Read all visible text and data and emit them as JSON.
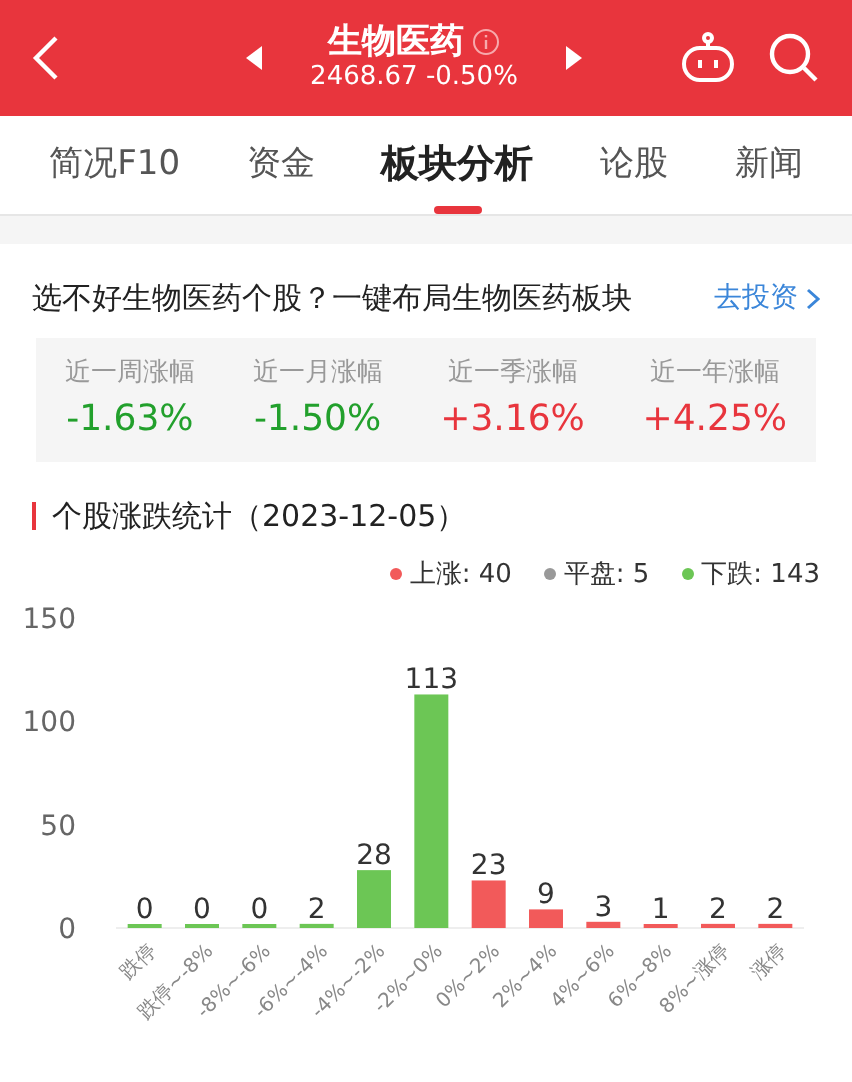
{
  "header": {
    "title": "生物医药",
    "subtitle": "2468.67 -0.50%"
  },
  "tabs": [
    {
      "label": "简况F10",
      "selected": false
    },
    {
      "label": "资金",
      "selected": false
    },
    {
      "label": "板块分析",
      "selected": true
    },
    {
      "label": "论股",
      "selected": false
    },
    {
      "label": "新闻",
      "selected": false
    }
  ],
  "promo": {
    "text": "选不好生物医药个股？一键布局生物医药板块",
    "link": "去投资"
  },
  "returns": [
    {
      "label": "近一周涨幅",
      "value": "-1.63%",
      "color": "#22a02c"
    },
    {
      "label": "近一月涨幅",
      "value": "-1.50%",
      "color": "#22a02c"
    },
    {
      "label": "近一季涨幅",
      "value": "+3.16%",
      "color": "#e8353d"
    },
    {
      "label": "近一年涨幅",
      "value": "+4.25%",
      "color": "#e8353d"
    }
  ],
  "stats": {
    "title": "个股涨跌统计（2023-12-05）",
    "legend": [
      {
        "label": "上涨: 40",
        "color": "#f25a5a"
      },
      {
        "label": "平盘: 5",
        "color": "#999999"
      },
      {
        "label": "下跌: 143",
        "color": "#6cc655"
      }
    ],
    "chart_data": {
      "type": "bar",
      "categories": [
        "跌停",
        "跌停~-8%",
        "-8%~-6%",
        "-6%~-4%",
        "-4%~-2%",
        "-2%~0%",
        "0%~2%",
        "2%~4%",
        "4%~6%",
        "6%~8%",
        "8%~涨停",
        "涨停"
      ],
      "series": [
        {
          "color": "#6cc655",
          "values": [
            0,
            0,
            0,
            2,
            28,
            113,
            null,
            null,
            null,
            null,
            null,
            null
          ]
        },
        {
          "color": "#f25a5a",
          "values": [
            null,
            null,
            null,
            null,
            null,
            null,
            23,
            9,
            3,
            1,
            2,
            2
          ]
        }
      ],
      "ylim": [
        0,
        150
      ],
      "yticks": [
        0,
        50,
        100,
        150
      ],
      "data_labels": true
    }
  }
}
